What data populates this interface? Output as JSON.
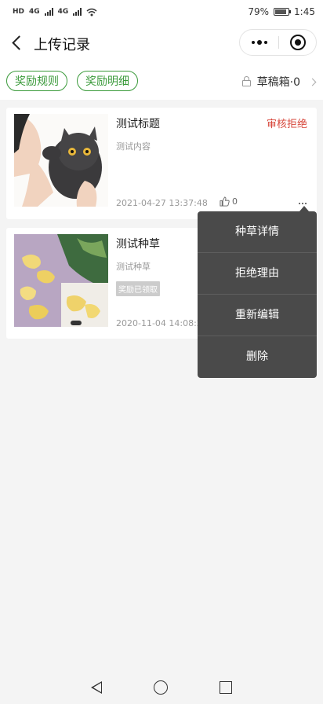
{
  "status_bar": {
    "network_left": "HD",
    "sig1": "4G",
    "sig2": "4G",
    "battery": "79%",
    "time": "1:45"
  },
  "nav": {
    "title": "上传记录"
  },
  "tabs": {
    "rules": "奖励规则",
    "details": "奖励明细",
    "drafts": "草稿箱·0"
  },
  "records": [
    {
      "title": "测试标题",
      "content": "测试内容",
      "status": "审核拒绝",
      "date": "2021-04-27 13:37:48",
      "likes": "0"
    },
    {
      "title": "测试种草",
      "content": "测试种草",
      "badge": "奖励已领取",
      "date": "2020-11-04 14:08:23"
    }
  ],
  "menu": {
    "items": [
      "种草详情",
      "拒绝理由",
      "重新编辑",
      "删除"
    ]
  },
  "colors": {
    "accent_green": "#3a9a3a",
    "reject_red": "#d7473b",
    "menu_bg": "#4a4a4a"
  }
}
